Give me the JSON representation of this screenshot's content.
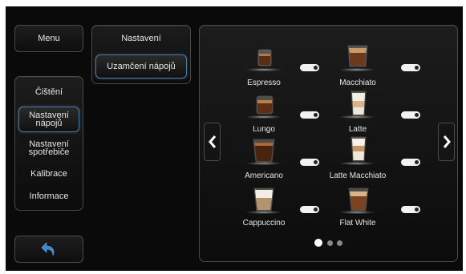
{
  "left_nav": {
    "menu_label": "Menu",
    "items": [
      {
        "label": "Čištění"
      },
      {
        "label": "Nastavení nápojů"
      },
      {
        "label": "Nastavení spotřebiče"
      },
      {
        "label": "Kalibrace"
      },
      {
        "label": "Informace"
      }
    ],
    "back_icon": "back-arrow-icon"
  },
  "sub_nav": {
    "title": "Nastavení",
    "active_item": "Uzamčení nápojů"
  },
  "drinks": [
    {
      "name": "Espresso",
      "enabled": true
    },
    {
      "name": "Macchiato",
      "enabled": true
    },
    {
      "name": "Lungo",
      "enabled": true
    },
    {
      "name": "Latte",
      "enabled": true
    },
    {
      "name": "Americano",
      "enabled": true
    },
    {
      "name": "Latte Macchiato",
      "enabled": true
    },
    {
      "name": "Cappuccino",
      "enabled": true
    },
    {
      "name": "Flat White",
      "enabled": true
    }
  ],
  "pagination": {
    "current": 1,
    "total": 3
  },
  "colors": {
    "accent_blue": "#4a7aa0",
    "text": "#e6e6e6",
    "toggle_on": "#f2f2f2"
  }
}
